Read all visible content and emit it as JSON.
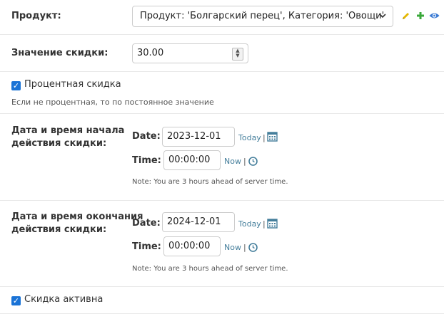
{
  "product": {
    "label": "Продукт:",
    "selected": "Продукт: 'Болгарский перец', Категория: 'Овощи'"
  },
  "discount_value": {
    "label": "Значение скидки:",
    "value": "30.00"
  },
  "percent_discount": {
    "label": "Процентная скидка",
    "help": "Если не процентная, то по постоянное значение",
    "checked": true
  },
  "start": {
    "label_line1": "Дата и время начала",
    "label_line2": "действия скидки:",
    "date_label": "Date:",
    "date_value": "2023-12-01",
    "today_link": "Today",
    "time_label": "Time:",
    "time_value": "00:00:00",
    "now_link": "Now",
    "note": "Note: You are 3 hours ahead of server time."
  },
  "end": {
    "label_line1": "Дата и время окончания",
    "label_line2": "действия скидки:",
    "date_label": "Date:",
    "date_value": "2024-12-01",
    "today_link": "Today",
    "time_label": "Time:",
    "time_value": "00:00:00",
    "now_link": "Now",
    "note": "Note: You are 3 hours ahead of server time."
  },
  "active": {
    "label": "Скидка активна",
    "checked": true
  },
  "separator": "|",
  "colors": {
    "link": "#447e9b",
    "checkbox": "#1a73d6",
    "edit_icon": "#e5b800",
    "add_icon": "#3aa83a",
    "view_icon": "#3b7bd4"
  },
  "icons": [
    "chevron-down-icon",
    "pencil-icon",
    "plus-icon",
    "eye-icon",
    "calendar-icon",
    "clock-icon",
    "check-icon"
  ]
}
